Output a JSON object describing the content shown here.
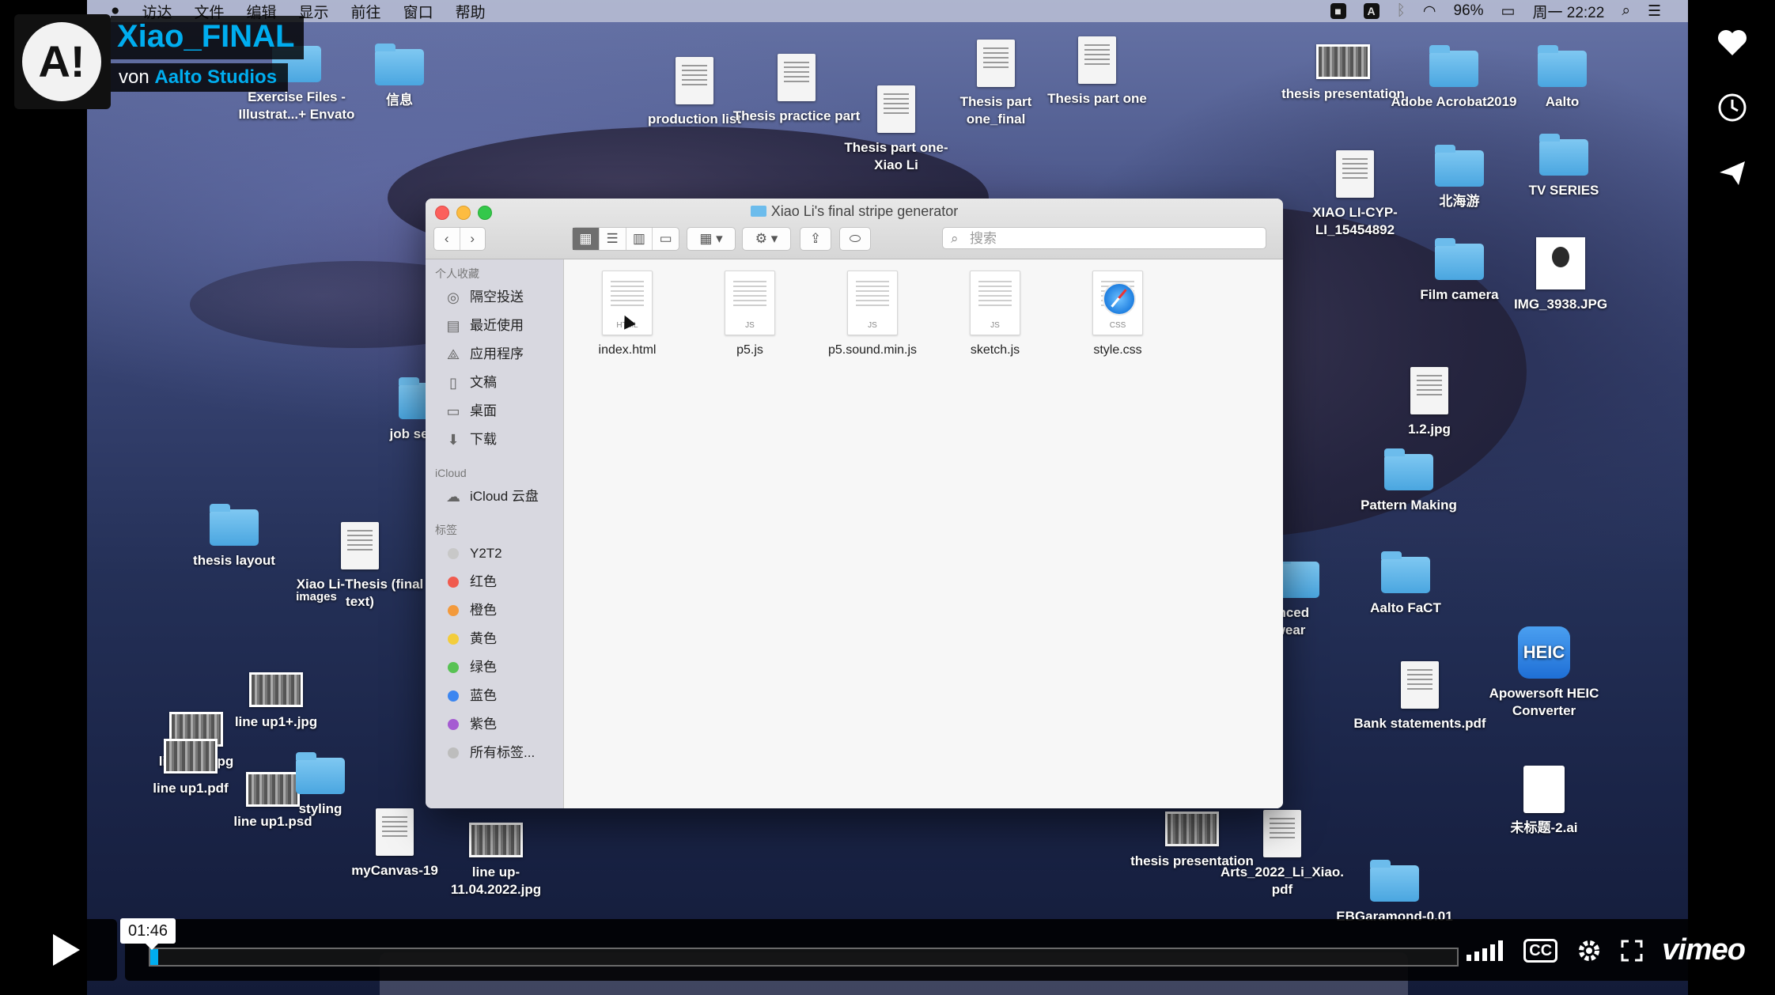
{
  "player": {
    "title": "Xiao_FINAL",
    "by_prefix": "von",
    "author": "Aalto Studios",
    "logo_text": "A!",
    "time": "01:46",
    "progress_fraction": 0.006,
    "vimeo_label": "vimeo",
    "cc_label": "CC",
    "side_buttons": [
      "heart-icon",
      "clock-icon",
      "send-icon"
    ]
  },
  "menubar": {
    "items": [
      "访达",
      "文件",
      "编辑",
      "显示",
      "前往",
      "窗口",
      "帮助"
    ],
    "battery": "96%",
    "clock": "周一 22:22"
  },
  "desktop": {
    "exercise_files": "Exercise Files - Illustrat...+ Envato",
    "xinxi": "信息",
    "production_list": "production list",
    "thesis_practice": "Thesis practice part",
    "thesis_part_one_xiao": "Thesis part one- Xiao Li",
    "thesis_part_one_final": "Thesis part one_final",
    "thesis_part_one": "Thesis part one",
    "thesis_presentation_top": "thesis presentation",
    "adobe": "Adobe Acrobat2019",
    "aalto": "Aalto",
    "xiaoli_cyp": "XIAO LI-CYP-LI_15454892",
    "beihaiyou": "北海游",
    "tv_series": "TV SERIES",
    "film_camera": "Film camera",
    "img_3938": "IMG_3938.JPG",
    "one_two_jpg": "1.2.jpg",
    "pattern_making": "Pattern Making",
    "job_search": "job search",
    "thesis_layout": "thesis layout",
    "xiao_thesis": "Xiao Li-Thesis (final text)",
    "images": "images",
    "aalto_fact": "Aalto FaCT",
    "advanced": "anced twear",
    "apowersoft": "Apowersoft HEIC Converter",
    "heic_label": "HEIC",
    "bank": "Bank statements.pdf",
    "line_up1_plus": "line up1+.jpg",
    "line_up1_jpg": "line up1.jpg",
    "line_up1_pdf": "line up1.pdf",
    "line_up1_psd": "line up1.psd",
    "styling": "styling",
    "mycanvas": "myCanvas-19",
    "line_date": "line up-11.04.2022.jpg",
    "thesis_presentation_bottom": "thesis presentation",
    "arts_pdf": "Arts_2022_Li_Xiao. pdf",
    "untitled_ai": "未标题-2.ai",
    "ebgaramond": "EBGaramond-0.01"
  },
  "finder": {
    "title": "Xiao Li's final stripe generator",
    "search_placeholder": "搜索",
    "sidebar": {
      "favorites_header": "个人收藏",
      "favorites": [
        {
          "label": "隔空投送",
          "icon": "airdrop-icon",
          "glyph": "◎"
        },
        {
          "label": "最近使用",
          "icon": "recents-icon",
          "glyph": "▤"
        },
        {
          "label": "应用程序",
          "icon": "applications-icon",
          "glyph": "⟁"
        },
        {
          "label": "文稿",
          "icon": "documents-icon",
          "glyph": "▯"
        },
        {
          "label": "桌面",
          "icon": "desktop-icon",
          "glyph": "▭"
        },
        {
          "label": "下载",
          "icon": "downloads-icon",
          "glyph": "⬇"
        }
      ],
      "icloud_header": "iCloud",
      "icloud_drive": "iCloud 云盘",
      "tags_header": "标签",
      "tags": [
        {
          "label": "Y2T2",
          "color": "#c8c8c8"
        },
        {
          "label": "红色",
          "color": "#f05b4f"
        },
        {
          "label": "橙色",
          "color": "#f39a3c"
        },
        {
          "label": "黄色",
          "color": "#f3cd3c"
        },
        {
          "label": "绿色",
          "color": "#58c254"
        },
        {
          "label": "蓝色",
          "color": "#3c86f0"
        },
        {
          "label": "紫色",
          "color": "#a55bd2"
        },
        {
          "label": "所有标签...",
          "color": "#bdbdbd"
        }
      ]
    },
    "files": [
      {
        "name": "index.html",
        "ext": "HTML"
      },
      {
        "name": "p5.js",
        "ext": "JS"
      },
      {
        "name": "p5.sound.min.js",
        "ext": "JS"
      },
      {
        "name": "sketch.js",
        "ext": "JS"
      },
      {
        "name": "style.css",
        "ext": "CSS"
      }
    ]
  }
}
